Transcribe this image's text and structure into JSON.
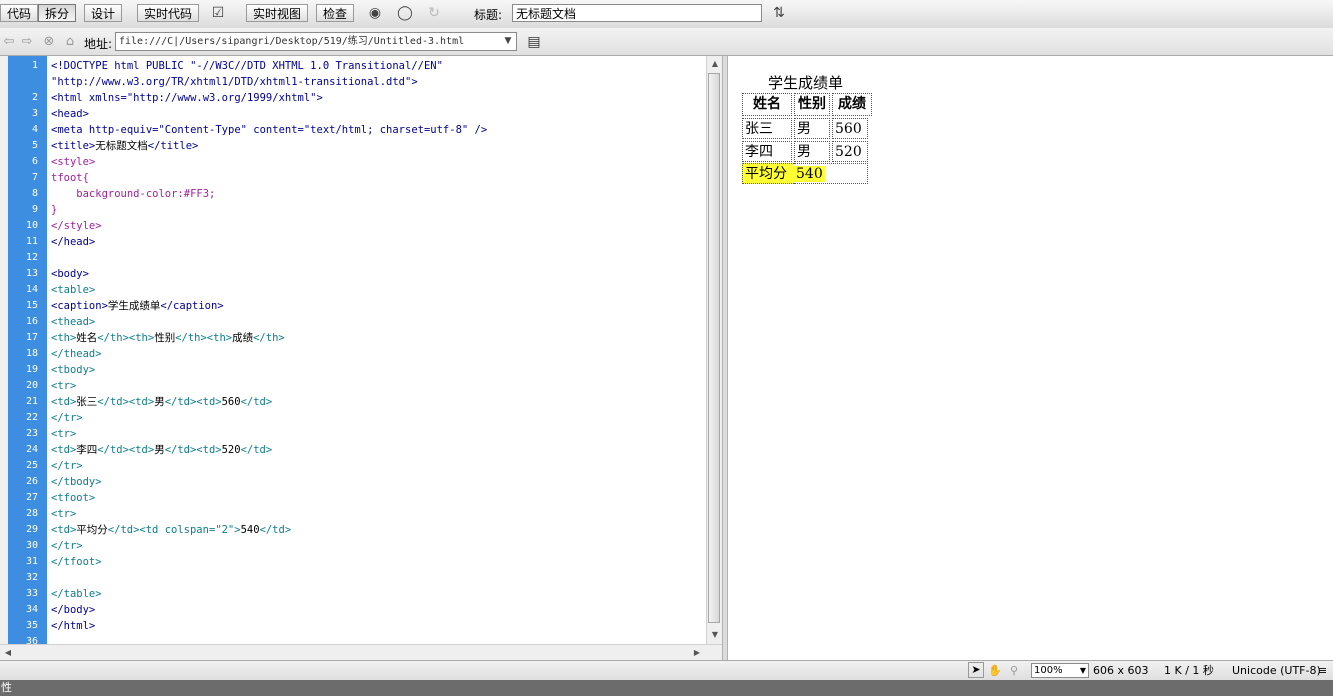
{
  "toolbar": {
    "code_label": "代码",
    "split_label": "拆分",
    "design_label": "设计",
    "live_code_label": "实时代码",
    "live_view_label": "实时视图",
    "inspect_label": "检查",
    "title_label": "标题:",
    "title_value": "无标题文档"
  },
  "addressbar": {
    "label": "地址:",
    "url": "file:///C|/Users/sipangri/Desktop/519/练习/Untitled-3.html"
  },
  "code": {
    "lines": [
      {
        "n": "1",
        "parts": [
          [
            "b",
            "<!DOCTYPE html PUBLIC \"-//W3C//DTD XHTML 1.0 Transitional//EN\""
          ]
        ]
      },
      {
        "n": "",
        "parts": [
          [
            "b",
            "\"http://www.w3.org/TR/xhtml1/DTD/xhtml1-transitional.dtd\">"
          ]
        ]
      },
      {
        "n": "2",
        "parts": [
          [
            "b",
            "<html xmlns=\"http://www.w3.org/1999/xhtml\">"
          ]
        ]
      },
      {
        "n": "3",
        "parts": [
          [
            "b",
            "<head>"
          ]
        ]
      },
      {
        "n": "4",
        "parts": [
          [
            "b",
            "<meta http-equiv=\"Content-Type\" content=\"text/html; charset=utf-8\" />"
          ]
        ]
      },
      {
        "n": "5",
        "parts": [
          [
            "b",
            "<title>"
          ],
          [
            "k",
            "无标题文档"
          ],
          [
            "b",
            "</title>"
          ]
        ]
      },
      {
        "n": "6",
        "parts": [
          [
            "p",
            "<style>"
          ]
        ]
      },
      {
        "n": "7",
        "parts": [
          [
            "p",
            "tfoot{"
          ]
        ]
      },
      {
        "n": "8",
        "parts": [
          [
            "p",
            "    background-color:#FF3;"
          ]
        ]
      },
      {
        "n": "9",
        "parts": [
          [
            "p",
            "}"
          ]
        ]
      },
      {
        "n": "10",
        "parts": [
          [
            "p",
            "</style>"
          ]
        ]
      },
      {
        "n": "11",
        "parts": [
          [
            "b",
            "</head>"
          ]
        ]
      },
      {
        "n": "12",
        "parts": []
      },
      {
        "n": "13",
        "parts": [
          [
            "b",
            "<body>"
          ]
        ]
      },
      {
        "n": "14",
        "parts": [
          [
            "t",
            "<table>"
          ]
        ]
      },
      {
        "n": "15",
        "parts": [
          [
            "b",
            "<caption>"
          ],
          [
            "k",
            "学生成绩单"
          ],
          [
            "b",
            "</caption>"
          ]
        ]
      },
      {
        "n": "16",
        "parts": [
          [
            "t",
            "<thead>"
          ]
        ]
      },
      {
        "n": "17",
        "parts": [
          [
            "t",
            "<th>"
          ],
          [
            "k",
            "姓名"
          ],
          [
            "t",
            "</th><th>"
          ],
          [
            "k",
            "性别"
          ],
          [
            "t",
            "</th><th>"
          ],
          [
            "k",
            "成绩"
          ],
          [
            "t",
            "</th>"
          ]
        ]
      },
      {
        "n": "18",
        "parts": [
          [
            "t",
            "</thead>"
          ]
        ]
      },
      {
        "n": "19",
        "parts": [
          [
            "t",
            "<tbody>"
          ]
        ]
      },
      {
        "n": "20",
        "parts": [
          [
            "t",
            "<tr>"
          ]
        ]
      },
      {
        "n": "21",
        "parts": [
          [
            "t",
            "<td>"
          ],
          [
            "k",
            "张三"
          ],
          [
            "t",
            "</td><td>"
          ],
          [
            "k",
            "男"
          ],
          [
            "t",
            "</td><td>"
          ],
          [
            "k",
            "560"
          ],
          [
            "t",
            "</td>"
          ]
        ]
      },
      {
        "n": "22",
        "parts": [
          [
            "t",
            "</tr>"
          ]
        ]
      },
      {
        "n": "23",
        "parts": [
          [
            "t",
            "<tr>"
          ]
        ]
      },
      {
        "n": "24",
        "parts": [
          [
            "t",
            "<td>"
          ],
          [
            "k",
            "李四"
          ],
          [
            "t",
            "</td><td>"
          ],
          [
            "k",
            "男"
          ],
          [
            "t",
            "</td><td>"
          ],
          [
            "k",
            "520"
          ],
          [
            "t",
            "</td>"
          ]
        ]
      },
      {
        "n": "25",
        "parts": [
          [
            "t",
            "</tr>"
          ]
        ]
      },
      {
        "n": "26",
        "parts": [
          [
            "t",
            "</tbody>"
          ]
        ]
      },
      {
        "n": "27",
        "parts": [
          [
            "t",
            "<tfoot>"
          ]
        ]
      },
      {
        "n": "28",
        "parts": [
          [
            "t",
            "<tr>"
          ]
        ]
      },
      {
        "n": "29",
        "parts": [
          [
            "t",
            "<td>"
          ],
          [
            "k",
            "平均分"
          ],
          [
            "t",
            "</td><td colspan=\"2\">"
          ],
          [
            "k",
            "540"
          ],
          [
            "t",
            "</td>"
          ]
        ]
      },
      {
        "n": "30",
        "parts": [
          [
            "t",
            "</tr>"
          ]
        ]
      },
      {
        "n": "31",
        "parts": [
          [
            "t",
            "</tfoot>"
          ]
        ]
      },
      {
        "n": "32",
        "parts": []
      },
      {
        "n": "33",
        "parts": [
          [
            "t",
            "</table>"
          ]
        ]
      },
      {
        "n": "34",
        "parts": [
          [
            "b",
            "</body>"
          ]
        ]
      },
      {
        "n": "35",
        "parts": [
          [
            "b",
            "</html>"
          ]
        ]
      },
      {
        "n": "36",
        "parts": []
      }
    ]
  },
  "design": {
    "caption": "学生成绩单",
    "headers": [
      "姓名",
      "性别",
      "成绩"
    ],
    "rows": [
      [
        "张三",
        "男",
        "560"
      ],
      [
        "李四",
        "男",
        "520"
      ]
    ],
    "footer": [
      "平均分",
      "540"
    ]
  },
  "status": {
    "zoom": "100%",
    "size": "606 x 603",
    "filesize": "1 K / 1 秒",
    "encoding": "Unicode (UTF-8)"
  },
  "bottom": {
    "label": "性"
  },
  "colors": {
    "gutter": "#3d8ee0",
    "tfoot_bg": "#FFFF33"
  }
}
